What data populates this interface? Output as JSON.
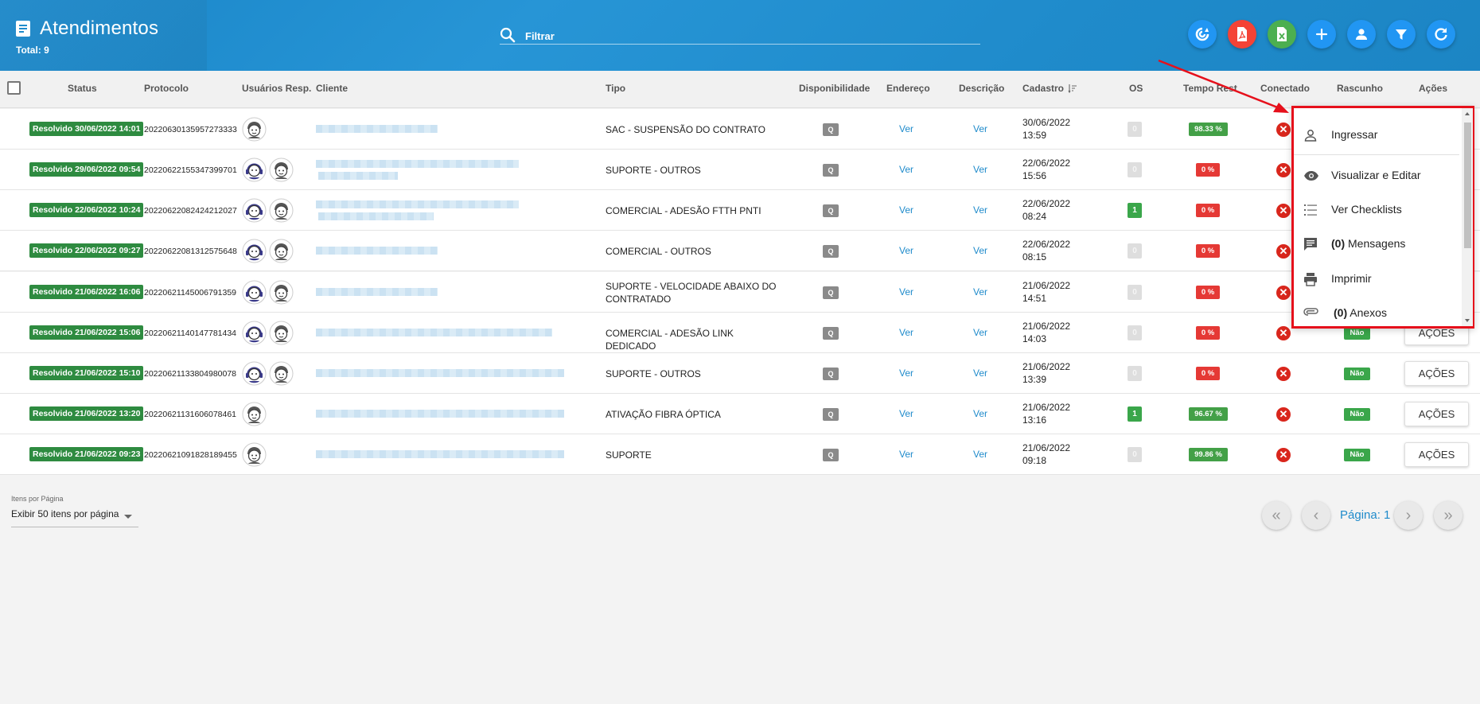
{
  "header": {
    "title": "Atendimentos",
    "total": "Total: 9",
    "filter_label": "Filtrar",
    "buttons": [
      {
        "name": "sync-icon",
        "color": "#2196f3"
      },
      {
        "name": "pdf-icon",
        "color": "#f44336"
      },
      {
        "name": "excel-icon",
        "color": "#4caf50"
      },
      {
        "name": "plus-icon",
        "color": "#2196f3"
      },
      {
        "name": "user-icon",
        "color": "#2196f3"
      },
      {
        "name": "filter-icon",
        "color": "#2196f3"
      },
      {
        "name": "refresh-icon",
        "color": "#2196f3"
      }
    ]
  },
  "table": {
    "columns": [
      "Status",
      "Protocolo",
      "Usuários Resp.",
      "Cliente",
      "Tipo",
      "Disponibilidade",
      "Endereço",
      "Descrição",
      "Cadastro",
      "OS",
      "Tempo Rest",
      "Conectado",
      "Rascunho",
      "Ações"
    ],
    "rows": [
      {
        "status": "Resolvido 30/06/2022 14:01",
        "protocolo": "20220630135957273333",
        "tipo": "SAC - SUSPENSÃO DO CONTRATO",
        "disp": "Q",
        "endereco": "Ver",
        "descricao": "Ver",
        "cad_date": "30/06/2022",
        "cad_time": "13:59",
        "os": "0",
        "tempo": "98.33 %",
        "conectado": "✕",
        "rascunho": "",
        "acoes": ""
      },
      {
        "status": "Resolvido 29/06/2022 09:54",
        "protocolo": "20220622155347399701",
        "tipo": "SUPORTE - OUTROS",
        "disp": "Q",
        "endereco": "Ver",
        "descricao": "Ver",
        "cad_date": "22/06/2022",
        "cad_time": "15:56",
        "os": "0",
        "tempo": "0 %",
        "conectado": "✕",
        "rascunho": "",
        "acoes": ""
      },
      {
        "status": "Resolvido 22/06/2022 10:24",
        "protocolo": "20220622082424212027",
        "tipo": "COMERCIAL - ADESÃO FTTH PNTI",
        "disp": "Q",
        "endereco": "Ver",
        "descricao": "Ver",
        "cad_date": "22/06/2022",
        "cad_time": "08:24",
        "os": "1",
        "tempo": "0 %",
        "conectado": "✕",
        "rascunho": "",
        "acoes": ""
      },
      {
        "status": "Resolvido 22/06/2022 09:27",
        "protocolo": "20220622081312575648",
        "tipo": "COMERCIAL - OUTROS",
        "disp": "Q",
        "endereco": "Ver",
        "descricao": "Ver",
        "cad_date": "22/06/2022",
        "cad_time": "08:15",
        "os": "0",
        "tempo": "0 %",
        "conectado": "✕",
        "rascunho": "",
        "acoes": ""
      },
      {
        "status": "Resolvido 21/06/2022 16:06",
        "protocolo": "20220621145006791359",
        "tipo": "SUPORTE - VELOCIDADE ABAIXO DO CONTRATADO",
        "disp": "Q",
        "endereco": "Ver",
        "descricao": "Ver",
        "cad_date": "21/06/2022",
        "cad_time": "14:51",
        "os": "0",
        "tempo": "0 %",
        "conectado": "✕",
        "rascunho": "",
        "acoes": ""
      },
      {
        "status": "Resolvido 21/06/2022 15:06",
        "protocolo": "20220621140147781434",
        "tipo": "COMERCIAL - ADESÃO LINK DEDICADO",
        "disp": "Q",
        "endereco": "Ver",
        "descricao": "Ver",
        "cad_date": "21/06/2022",
        "cad_time": "14:03",
        "os": "0",
        "tempo": "0 %",
        "conectado": "✕",
        "rascunho": "Não",
        "acoes": "AÇÕES"
      },
      {
        "status": "Resolvido 21/06/2022 15:10",
        "protocolo": "20220621133804980078",
        "tipo": "SUPORTE - OUTROS",
        "disp": "Q",
        "endereco": "Ver",
        "descricao": "Ver",
        "cad_date": "21/06/2022",
        "cad_time": "13:39",
        "os": "0",
        "tempo": "0 %",
        "conectado": "✕",
        "rascunho": "Não",
        "acoes": "AÇÕES"
      },
      {
        "status": "Resolvido 21/06/2022 13:20",
        "protocolo": "20220621131606078461",
        "tipo": "ATIVAÇÃO FIBRA ÓPTICA",
        "disp": "Q",
        "endereco": "Ver",
        "descricao": "Ver",
        "cad_date": "21/06/2022",
        "cad_time": "13:16",
        "os": "1",
        "tempo": "96.67 %",
        "conectado": "✕",
        "rascunho": "Não",
        "acoes": "AÇÕES"
      },
      {
        "status": "Resolvido 21/06/2022 09:23",
        "protocolo": "20220621091828189455",
        "tipo": "SUPORTE",
        "disp": "Q",
        "endereco": "Ver",
        "descricao": "Ver",
        "cad_date": "21/06/2022",
        "cad_time": "09:18",
        "os": "0",
        "tempo": "99.86 %",
        "conectado": "✕",
        "rascunho": "Não",
        "acoes": "AÇÕES"
      }
    ]
  },
  "footer": {
    "items_label": "Itens por Página",
    "items_value": "Exibir 50 itens por página",
    "page_label": "Página: 1"
  },
  "menu": {
    "ingressar": "Ingressar",
    "visualizar": "Visualizar e Editar",
    "checklists": "Ver Checklists",
    "msg_count": "(0)",
    "mensagens": "Mensagens",
    "imprimir": "Imprimir",
    "anexos_count": "(0)",
    "anexos": "Anexos"
  },
  "colors": {
    "header": "#1f8bcb",
    "status_green": "#2e8b40",
    "tempo_red": "#e53935",
    "tempo_green": "#43a047",
    "highlight": "#e6101b"
  }
}
